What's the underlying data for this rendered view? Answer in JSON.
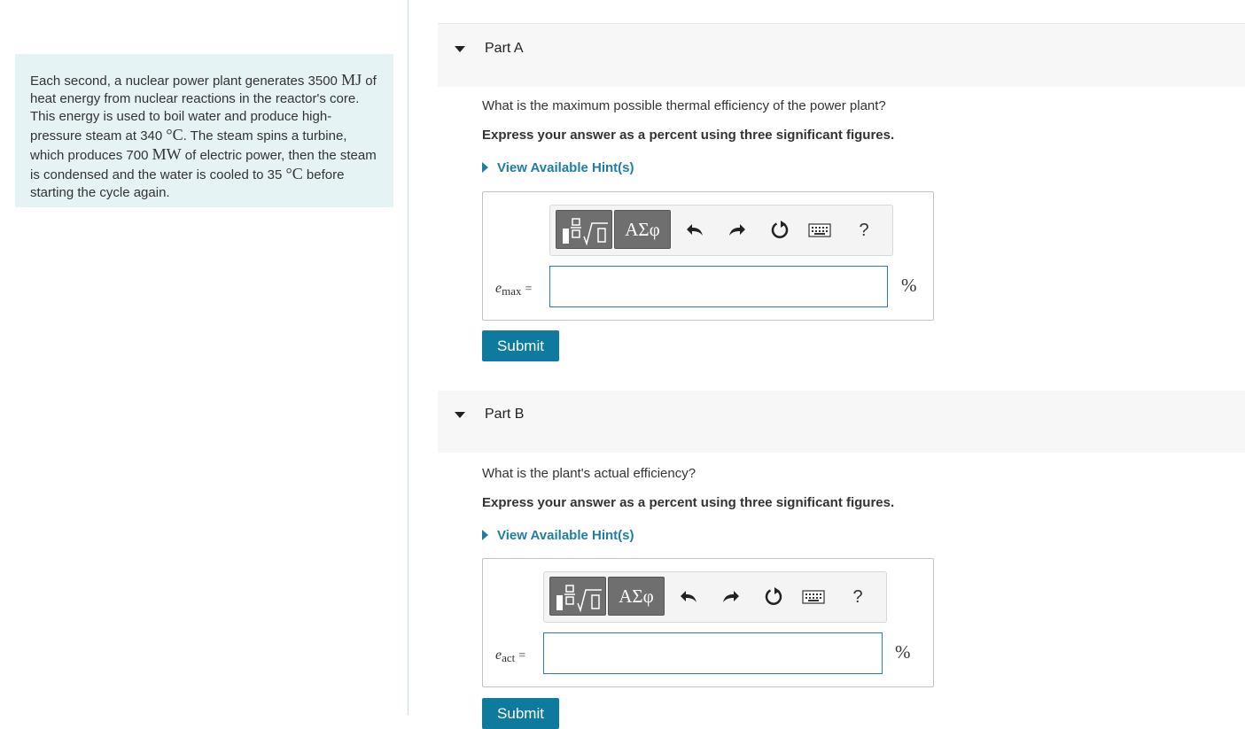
{
  "problem": {
    "t1": "Each second, a nuclear power plant generates 3500 ",
    "u1": "MJ",
    "t2": " of heat energy from nuclear reactions in the reactor's core. This energy is used to boil water and produce high-pressure steam at 340 ",
    "u2": "°C",
    "t3": ". The steam spins a turbine, which produces 700 ",
    "u3": "MW",
    "t4": " of electric power, then the steam is condensed and the water is cooled to 35 ",
    "u4": "°C",
    "t5": " before starting the cycle again."
  },
  "toolbar": {
    "greek_label": "ΑΣφ",
    "help_label": "?"
  },
  "parts": [
    {
      "title": "Part A",
      "question": "What is the maximum possible thermal efficiency of the power plant?",
      "instruction": "Express your answer as a percent using three significant figures.",
      "hint_link": "View Available Hint(s)",
      "var": "e",
      "var_sub": "max",
      "equals": "=",
      "input_value": "",
      "unit": "%",
      "submit": "Submit"
    },
    {
      "title": "Part B",
      "question": "What is the plant's actual efficiency?",
      "instruction": "Express your answer as a percent using three significant figures.",
      "hint_link": "View Available Hint(s)",
      "var": "e",
      "var_sub": "act",
      "equals": "=",
      "input_value": "",
      "unit": "%",
      "submit": "Submit"
    }
  ],
  "colors": {
    "problem_bg": "#e5f3f5",
    "link": "#1f7ea0",
    "submit_bg": "#0d7a9e",
    "input_border": "#2a7bb5"
  }
}
